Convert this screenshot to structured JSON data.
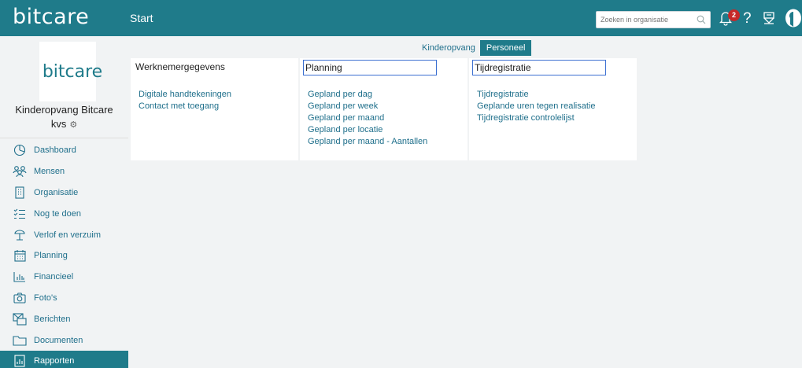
{
  "app": {
    "logo": "bitcare",
    "page_title": "Start"
  },
  "header": {
    "search_placeholder": "Zoeken in organisatie",
    "notification_count": "2",
    "help_label": "?"
  },
  "sidebar": {
    "org_logo_text": "bitcare",
    "org_name": "Kinderopvang Bitcare",
    "org_sub": "kvs",
    "items": [
      {
        "label": "Dashboard",
        "icon": "pie-chart-icon"
      },
      {
        "label": "Mensen",
        "icon": "people-icon"
      },
      {
        "label": "Organisatie",
        "icon": "building-icon"
      },
      {
        "label": "Nog te doen",
        "icon": "checklist-icon"
      },
      {
        "label": "Verlof en verzuim",
        "icon": "beach-umbrella-icon"
      },
      {
        "label": "Planning",
        "icon": "calendar-icon"
      },
      {
        "label": "Financieel",
        "icon": "bar-chart-icon"
      },
      {
        "label": "Foto's",
        "icon": "camera-icon"
      },
      {
        "label": "Berichten",
        "icon": "messages-icon"
      },
      {
        "label": "Documenten",
        "icon": "folder-icon"
      },
      {
        "label": "Rapporten",
        "icon": "report-icon"
      }
    ],
    "active_index": 10
  },
  "main": {
    "toggle": {
      "option_a": "Kinderopvang",
      "option_b": "Personeel",
      "selected": "Personeel"
    },
    "cards": [
      {
        "title": "Werknemergegevens",
        "links": [
          "Digitale handtekeningen",
          "Contact met toegang"
        ]
      },
      {
        "title": "Planning",
        "links": [
          "Gepland per dag",
          "Gepland per week",
          "Gepland per maand",
          "Gepland per locatie",
          "Gepland per maand - Aantallen"
        ]
      },
      {
        "title": "Tijdregistratie",
        "links": [
          "Tijdregistratie",
          "Geplande uren tegen realisatie",
          "Tijdregistratie controlelijst"
        ]
      }
    ]
  },
  "colors": {
    "brand": "#1f7b8a",
    "link": "#1f6f8b",
    "badge": "#c62828",
    "focus_border": "#3b6fd1"
  }
}
